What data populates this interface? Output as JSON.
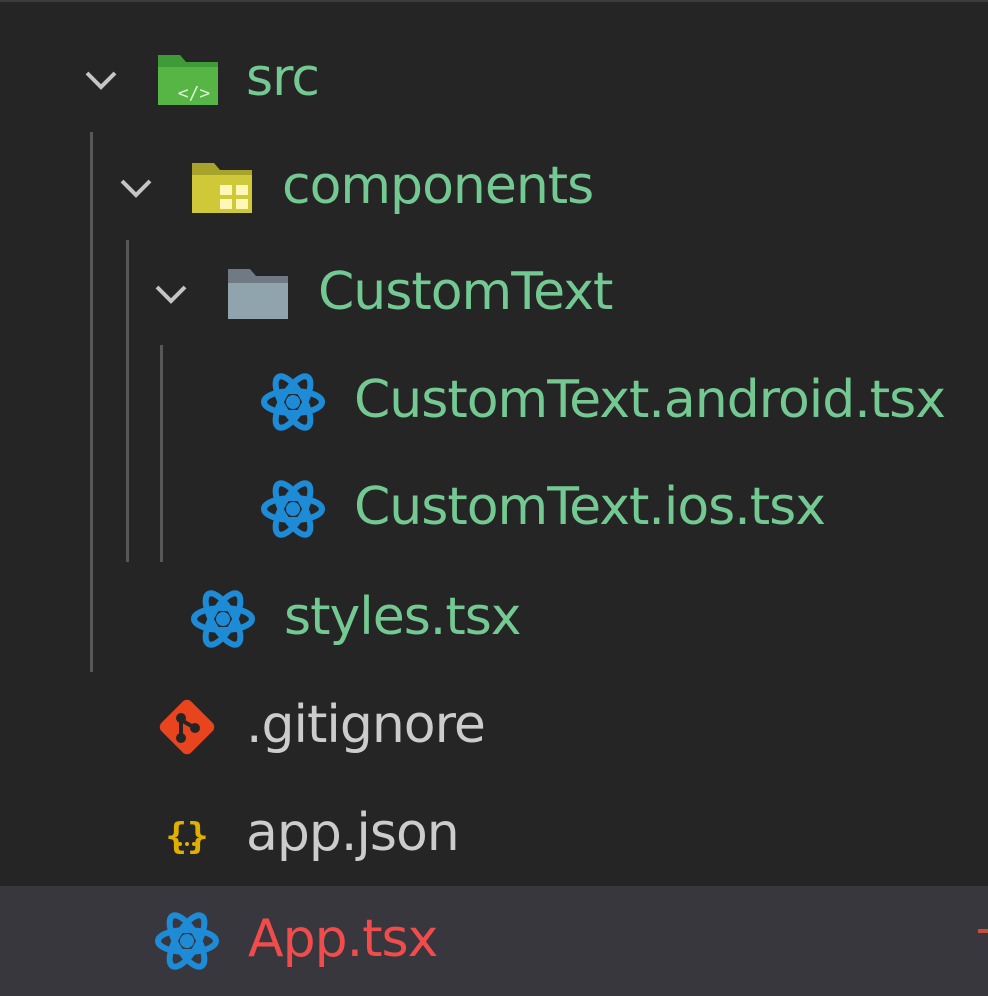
{
  "explorer": {
    "items": [
      {
        "label": "src",
        "type": "folder",
        "expanded": true,
        "status": "modified",
        "icon": "folder-src-icon"
      },
      {
        "label": "components",
        "type": "folder",
        "expanded": true,
        "status": "modified",
        "icon": "folder-components-icon"
      },
      {
        "label": "CustomText",
        "type": "folder",
        "expanded": true,
        "status": "modified",
        "icon": "folder-icon"
      },
      {
        "label": "CustomText.android.tsx",
        "type": "file",
        "status": "modified",
        "icon": "react-icon"
      },
      {
        "label": "CustomText.ios.tsx",
        "type": "file",
        "status": "modified",
        "icon": "react-icon"
      },
      {
        "label": "styles.tsx",
        "type": "file",
        "status": "modified",
        "icon": "react-icon"
      },
      {
        "label": ".gitignore",
        "type": "file",
        "status": "unchanged",
        "icon": "git-icon"
      },
      {
        "label": "app.json",
        "type": "file",
        "status": "unchanged",
        "icon": "json-icon"
      },
      {
        "label": "App.tsx",
        "type": "file",
        "status": "error",
        "selected": true,
        "icon": "react-icon"
      }
    ]
  },
  "colors": {
    "background": "#252526",
    "selected_row": "#37373d",
    "modified_text": "#73c991",
    "default_text": "#cccccc",
    "error_text": "#f14c4c",
    "indent_guide": "#585858",
    "react_blue": "#1e8bd6",
    "git_orange": "#e8441d",
    "json_yellow": "#e0b000"
  }
}
